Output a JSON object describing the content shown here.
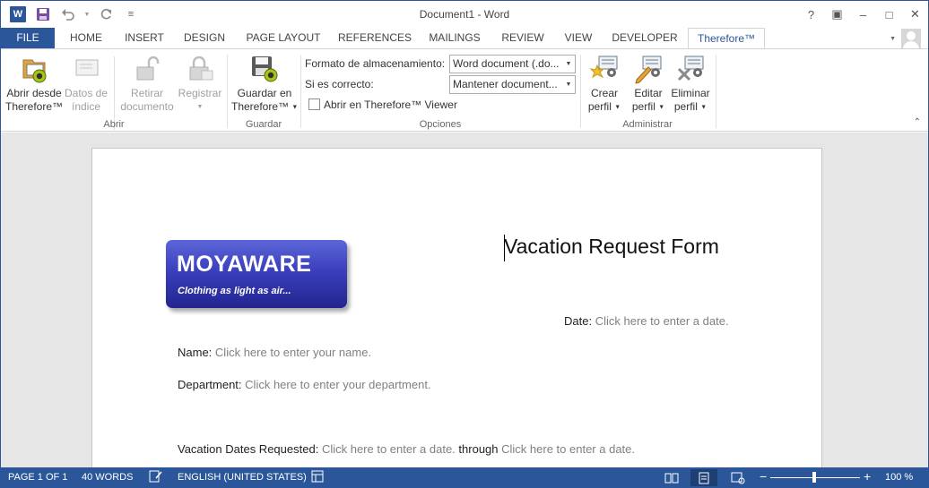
{
  "window": {
    "title": "Document1 - Word",
    "help": "?",
    "controls": {
      "ribbon_display": "▣",
      "minimize": "–",
      "maximize": "□",
      "close": "✕"
    }
  },
  "qat": {
    "app_letter": "W",
    "customize": "≡"
  },
  "tabs": [
    {
      "label": "FILE"
    },
    {
      "label": "HOME"
    },
    {
      "label": "INSERT"
    },
    {
      "label": "DESIGN"
    },
    {
      "label": "PAGE LAYOUT"
    },
    {
      "label": "REFERENCES"
    },
    {
      "label": "MAILINGS"
    },
    {
      "label": "REVIEW"
    },
    {
      "label": "VIEW"
    },
    {
      "label": "DEVELOPER"
    },
    {
      "label": "Therefore™"
    }
  ],
  "ribbon": {
    "abrir": {
      "label": "Abrir",
      "open_from": {
        "line1": "Abrir desde",
        "line2": "Therefore™"
      },
      "index_data": {
        "line1": "Datos de",
        "line2": "índice"
      }
    },
    "checkout": {
      "line1": "Retirar",
      "line2": "documento"
    },
    "register": {
      "line1": "Registrar"
    },
    "guardar": {
      "label": "Guardar",
      "save_in": {
        "line1": "Guardar en",
        "line2": "Therefore™"
      }
    },
    "opciones": {
      "label": "Opciones",
      "format_label": "Formato de almacenamiento:",
      "format_value": "Word document (.do...",
      "if_correct_label": "Si es correcto:",
      "if_correct_value": "Mantener document...",
      "viewer_checkbox": "Abrir en Therefore™ Viewer"
    },
    "administrar": {
      "label": "Administrar",
      "create": {
        "line1": "Crear",
        "line2": "perfil"
      },
      "edit": {
        "line1": "Editar",
        "line2": "perfil"
      },
      "delete": {
        "line1": "Eliminar",
        "line2": "perfil"
      }
    }
  },
  "document": {
    "logo": {
      "brand": "MOYAWARE",
      "tagline": "Clothing as light as air..."
    },
    "title": "Vacation Request Form",
    "date": {
      "label": "Date:",
      "placeholder": "Click here to enter a date."
    },
    "name": {
      "label": "Name:",
      "placeholder": "Click here to enter your name."
    },
    "department": {
      "label": "Department:",
      "placeholder": "Click here to enter your department."
    },
    "vacation": {
      "label": "Vacation Dates Requested:",
      "start_placeholder": "Click here to enter a date.",
      "through": "through",
      "end_placeholder": "Click here to enter a date."
    }
  },
  "status": {
    "page": "PAGE 1 OF 1",
    "words": "40 WORDS",
    "language": "ENGLISH (UNITED STATES)",
    "zoom": "100 %",
    "zoom_minus": "−",
    "zoom_plus": "+"
  },
  "colors": {
    "accent": "#2b579a",
    "placeholder": "#808080"
  }
}
